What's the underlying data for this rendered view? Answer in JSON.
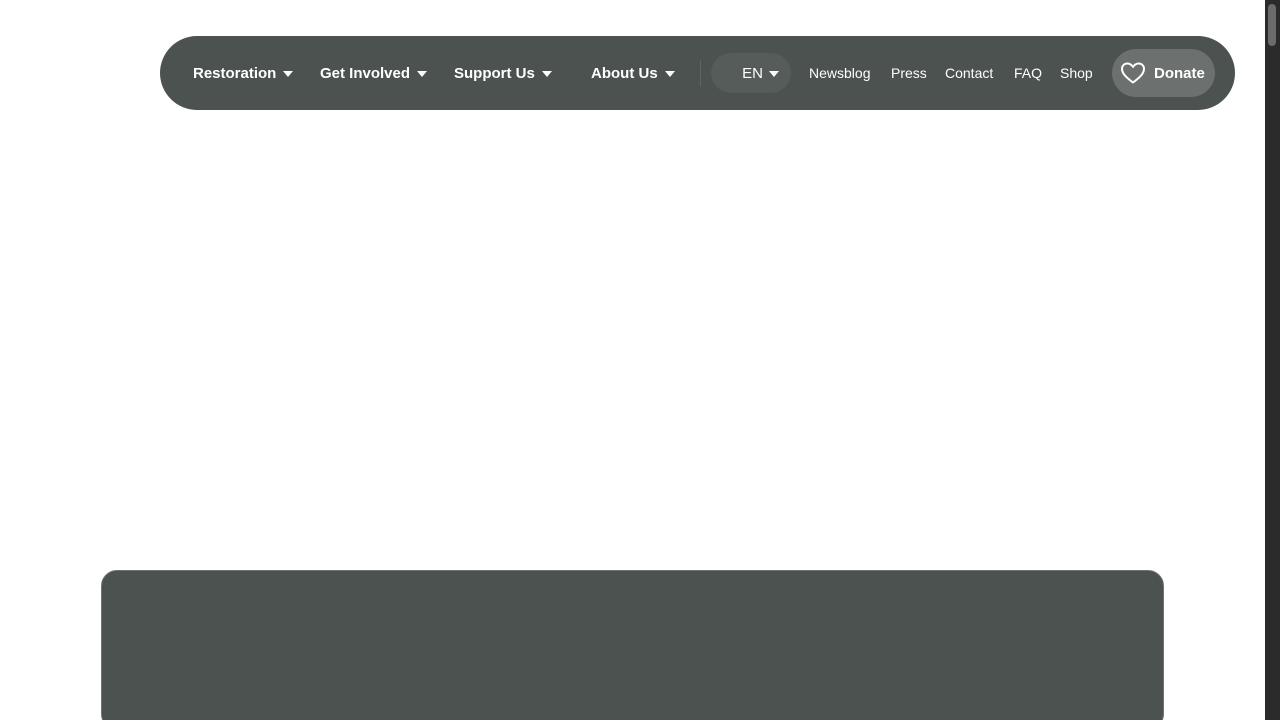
{
  "navbar": {
    "menus": [
      {
        "label": "Restoration"
      },
      {
        "label": "Get Involved"
      },
      {
        "label": "Support Us"
      },
      {
        "label": "About Us"
      }
    ],
    "language": {
      "selected": "EN"
    },
    "links": [
      {
        "label": "Newsblog"
      },
      {
        "label": "Press"
      },
      {
        "label": "Contact"
      },
      {
        "label": "FAQ"
      },
      {
        "label": "Shop"
      }
    ],
    "donate": {
      "label": "Donate",
      "icon": "heart-icon"
    }
  },
  "colors": {
    "nav_background": "#4b524f",
    "donate_background": "#6c706e",
    "card_background": "#4b524f",
    "text": "#ffffff"
  }
}
